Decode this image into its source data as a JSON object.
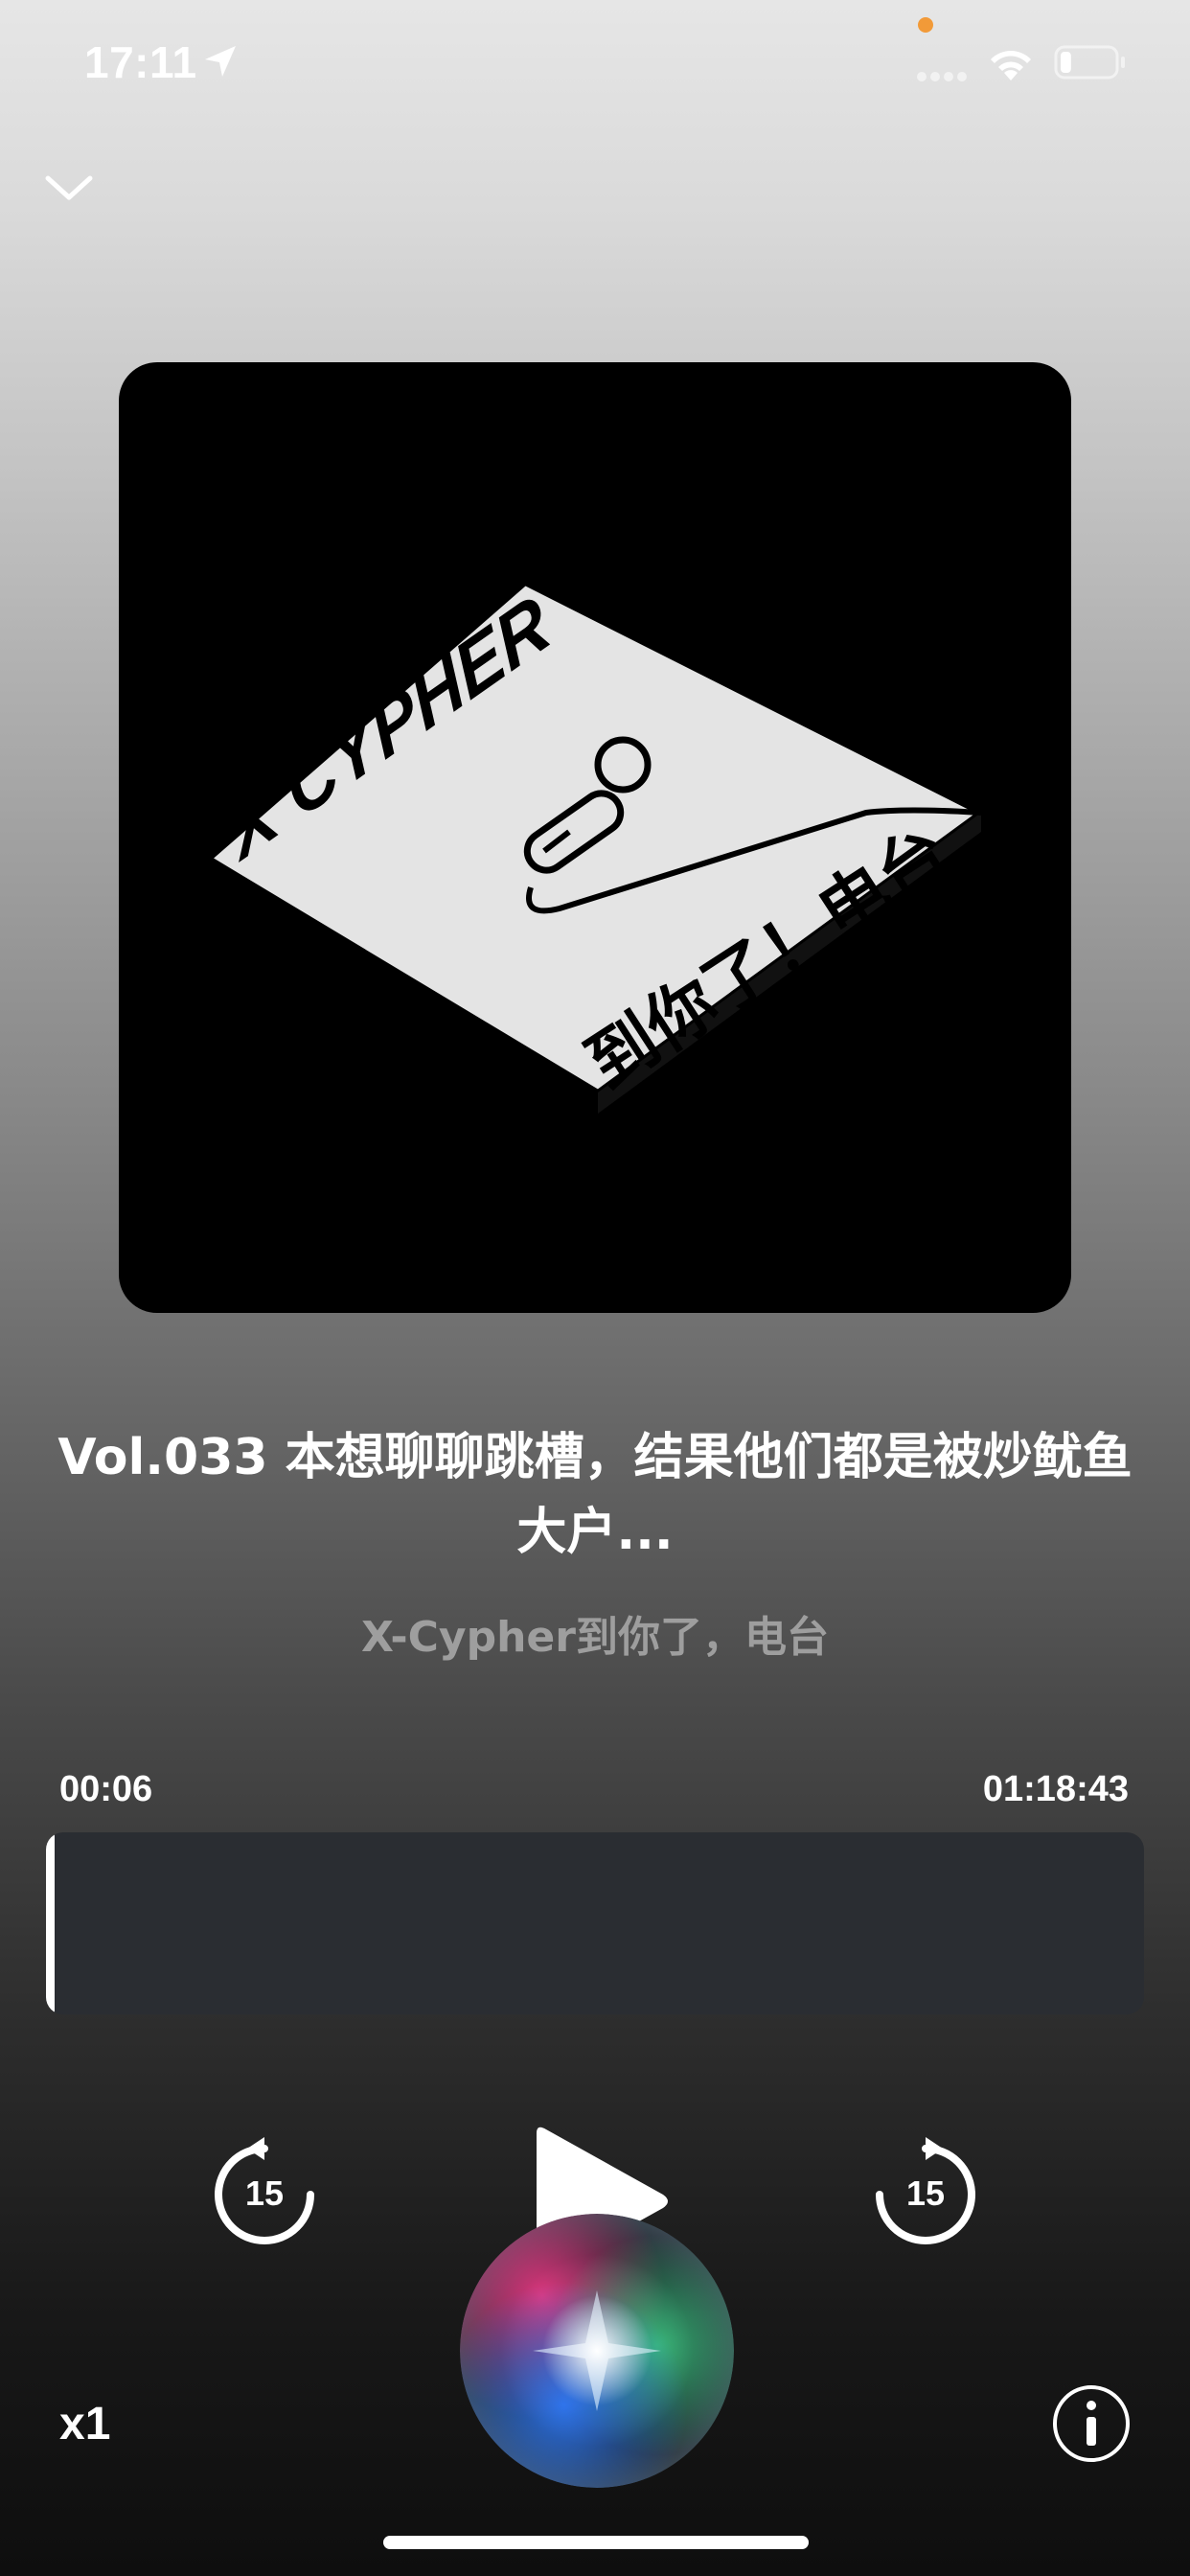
{
  "status_bar": {
    "time": "17:11",
    "location_icon": "location-arrow-icon",
    "signal_icon": "cellular-signal-icon",
    "wifi_icon": "wifi-icon",
    "battery_icon": "battery-icon",
    "battery_level": 0.2,
    "privacy_indicator_color": "#f29a38"
  },
  "header": {
    "collapse_icon": "chevron-down-icon"
  },
  "artwork": {
    "title_text": "X CYPHER",
    "subtitle_text": "到你了！电台",
    "icon": "microphone-icon"
  },
  "episode": {
    "title": "Vol.033 本想聊聊跳槽，结果他们都是被炒鱿鱼大户...",
    "podcast": "X-Cypher到你了，电台"
  },
  "progress": {
    "elapsed": "00:06",
    "total": "01:18:43",
    "fraction": 0.0013
  },
  "controls": {
    "skip_back_seconds": "15",
    "skip_forward_seconds": "15",
    "play_icon": "play-icon",
    "speed": "x1",
    "info_icon": "info-icon",
    "siri_icon": "siri-orb-icon"
  },
  "colors": {
    "scrubber_bg": "#2a2d32",
    "text_primary": "#ffffff",
    "text_secondary": "#9e9e9e"
  }
}
